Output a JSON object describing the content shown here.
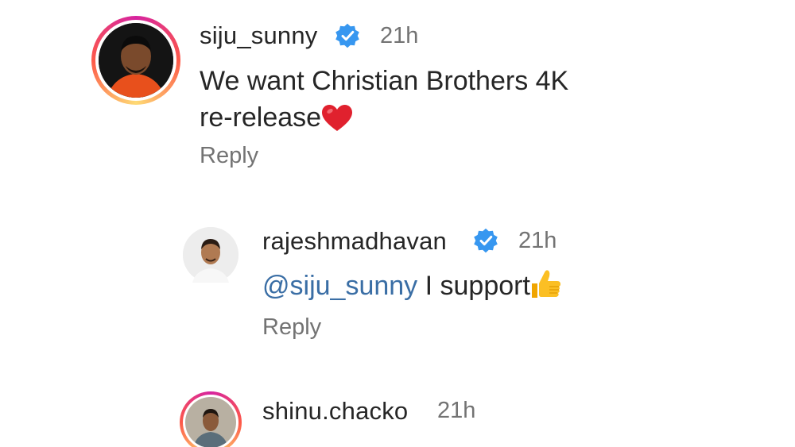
{
  "comments": [
    {
      "username": "siju_sunny",
      "verified": true,
      "time": "21h",
      "text_line1": "We want Christian Brothers 4K",
      "text_line2": "re-release",
      "emoji": "heart-icon",
      "reply_label": "Reply"
    },
    {
      "username": "rajeshmadhavan",
      "verified": true,
      "time": "21h",
      "mention": "@siju_sunny",
      "text": " I support",
      "emoji": "thumbs-up-icon",
      "reply_label": "Reply"
    },
    {
      "username": "shinu.chacko",
      "verified": false,
      "time": "21h"
    }
  ],
  "colors": {
    "text": "#262626",
    "muted": "#737373",
    "mention": "#3a6ea5",
    "verified": "#3797f0",
    "story_ring": "#d6249f"
  }
}
